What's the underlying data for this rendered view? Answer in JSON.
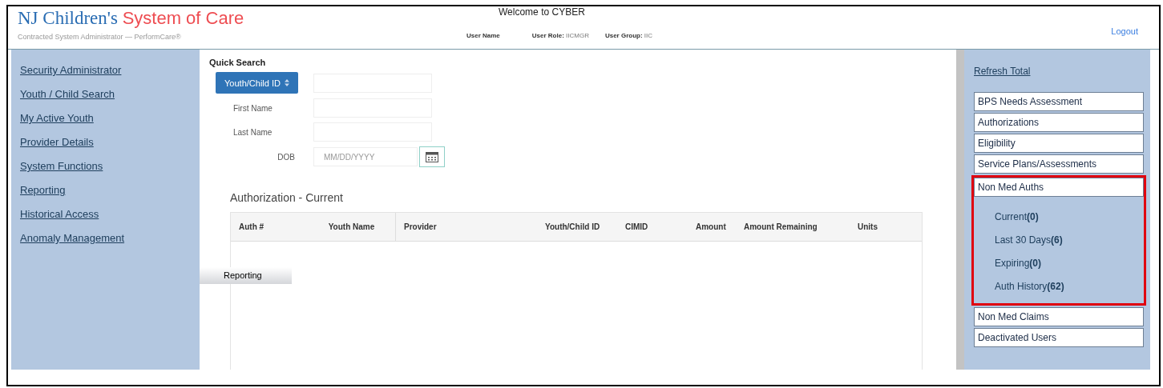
{
  "header": {
    "title_main": "NJ Children's",
    "title_accent": "System of Care",
    "subtitle": "Contracted System Administrator — PerformCare®",
    "welcome": "Welcome to CYBER",
    "user_name": "User Name",
    "user_role_label": "User Role:",
    "user_role": "IICMGR",
    "user_group_label": "User Group:",
    "user_group": "IIC",
    "logout": "Logout"
  },
  "sidebar": {
    "items": [
      {
        "label": "Security Administrator"
      },
      {
        "label": "Youth / Child Search"
      },
      {
        "label": "My Active Youth"
      },
      {
        "label": "Provider Details"
      },
      {
        "label": "System Functions"
      },
      {
        "label": "Reporting"
      },
      {
        "label": "Historical Access"
      },
      {
        "label": "Anomaly Management"
      }
    ]
  },
  "tooltip": "Reporting",
  "quick_search": {
    "title": "Quick Search",
    "id_selector": "Youth/Child ID",
    "fields": [
      {
        "label": "First Name"
      },
      {
        "label": "Last Name"
      }
    ],
    "dob": {
      "label": "DOB",
      "placeholder": "MM/DD/YYYY"
    }
  },
  "table": {
    "title": "Authorization - Current",
    "columns": [
      "Auth #",
      "Youth Name",
      "Provider",
      "Youth/Child ID",
      "CIMID",
      "Amount",
      "Amount Remaining",
      "Units"
    ]
  },
  "right_panel": {
    "refresh": "Refresh Total",
    "sections": [
      {
        "label": "BPS Needs Assessment",
        "highlighted": false
      },
      {
        "label": "Authorizations",
        "highlighted": false
      },
      {
        "label": "Eligibility",
        "highlighted": false
      },
      {
        "label": "Service Plans/Assessments",
        "highlighted": false
      },
      {
        "label": "Non Med Auths",
        "highlighted": true,
        "children": [
          "Current**(0)**",
          "Last 30 Days**(6)**",
          "Expiring**(0)**",
          "Auth History**(62)**"
        ]
      },
      {
        "label": "Non Med Claims",
        "highlighted": false
      },
      {
        "label": "Deactivated Users",
        "highlighted": false
      }
    ]
  }
}
